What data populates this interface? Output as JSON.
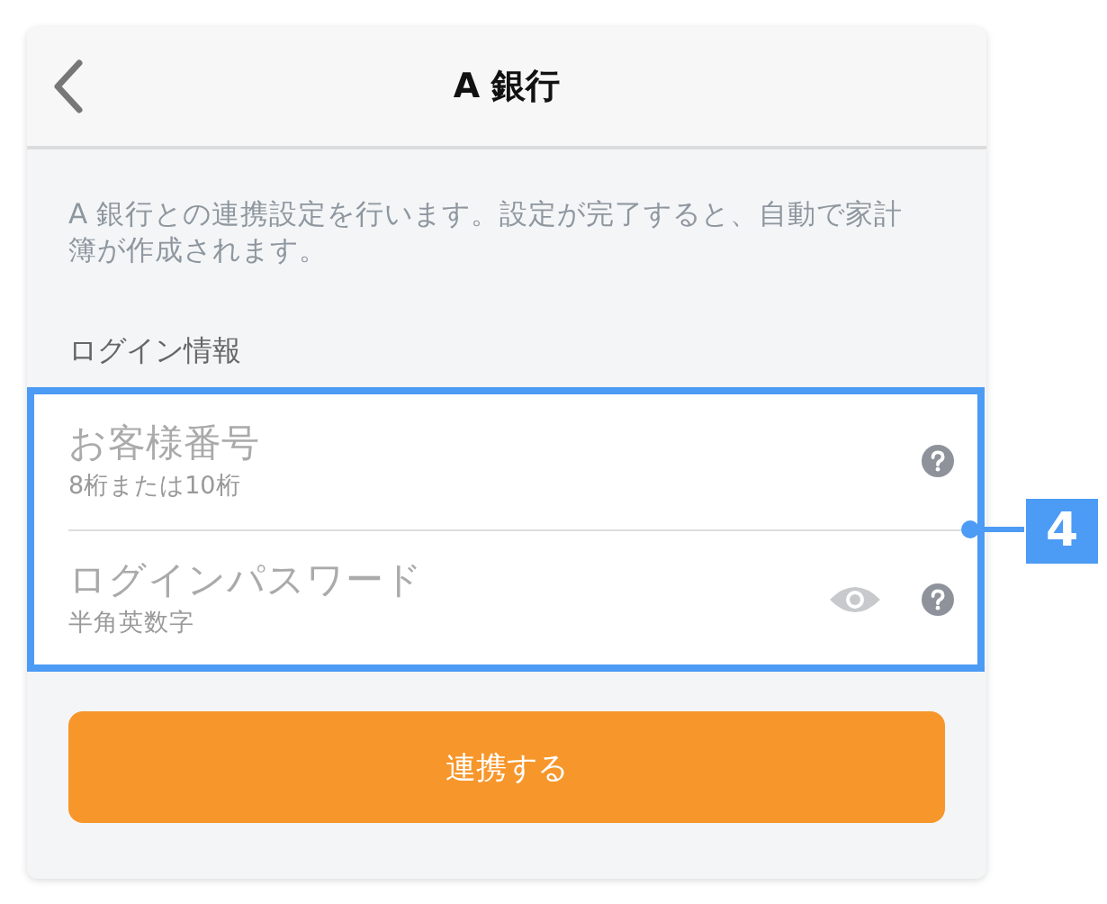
{
  "header": {
    "title": "A 銀行"
  },
  "description": "A 銀行との連携設定を行います。設定が完了すると、自動で家計簿が作成されます。",
  "section_label": "ログイン情報",
  "fields": [
    {
      "kind": "text",
      "placeholder": "お客様番号",
      "hint": "8桁または10桁"
    },
    {
      "kind": "password",
      "placeholder": "ログインパスワード",
      "hint": "半角英数字"
    }
  ],
  "submit_button": "連携する",
  "annotation": {
    "label": "4"
  }
}
